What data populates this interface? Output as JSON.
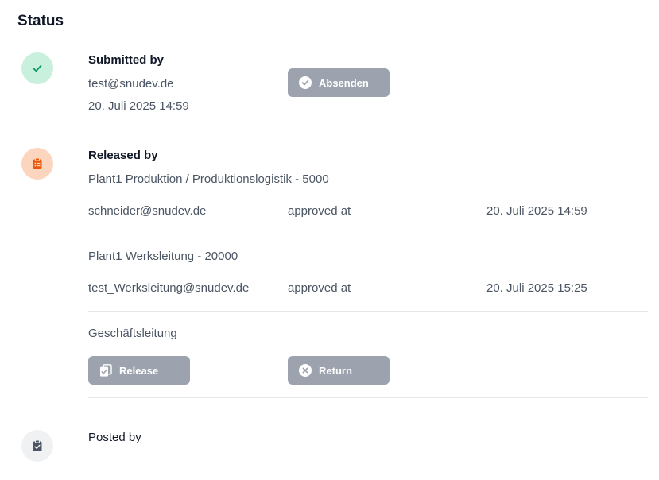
{
  "status_title": "Status",
  "submitted": {
    "heading": "Submitted by",
    "email": "test@snudev.de",
    "date": "20. Juli 2025 14:59",
    "button_label": "Absenden"
  },
  "released": {
    "heading": "Released by",
    "groups": [
      {
        "unit": "Plant1 Produktion / Produktionslogistik - 5000",
        "email": "schneider@snudev.de",
        "status": "approved at",
        "date": "20. Juli 2025 14:59"
      },
      {
        "unit": "Plant1 Werksleitung - 20000",
        "email": "test_Werksleitung@snudev.de",
        "status": "approved at",
        "date": "20. Juli 2025 15:25"
      }
    ],
    "pending": {
      "unit": "Geschäftsleitung",
      "release_label": "Release",
      "return_label": "Return"
    }
  },
  "posted": {
    "heading": "Posted by"
  },
  "colors": {
    "success_bg": "#c8f0dc",
    "success_icon": "#059669",
    "warning_bg": "#fbd5bd",
    "warning_icon": "#ea580c",
    "neutral_bg": "#f0f1f3",
    "neutral_icon": "#4b5563",
    "button_bg": "#9ca3af"
  },
  "icons": {
    "submitted": "check-icon",
    "released": "clipboard-list-icon",
    "posted": "clipboard-check-icon",
    "absenden": "check-circle-icon",
    "release": "documents-check-icon",
    "return": "x-circle-icon"
  }
}
